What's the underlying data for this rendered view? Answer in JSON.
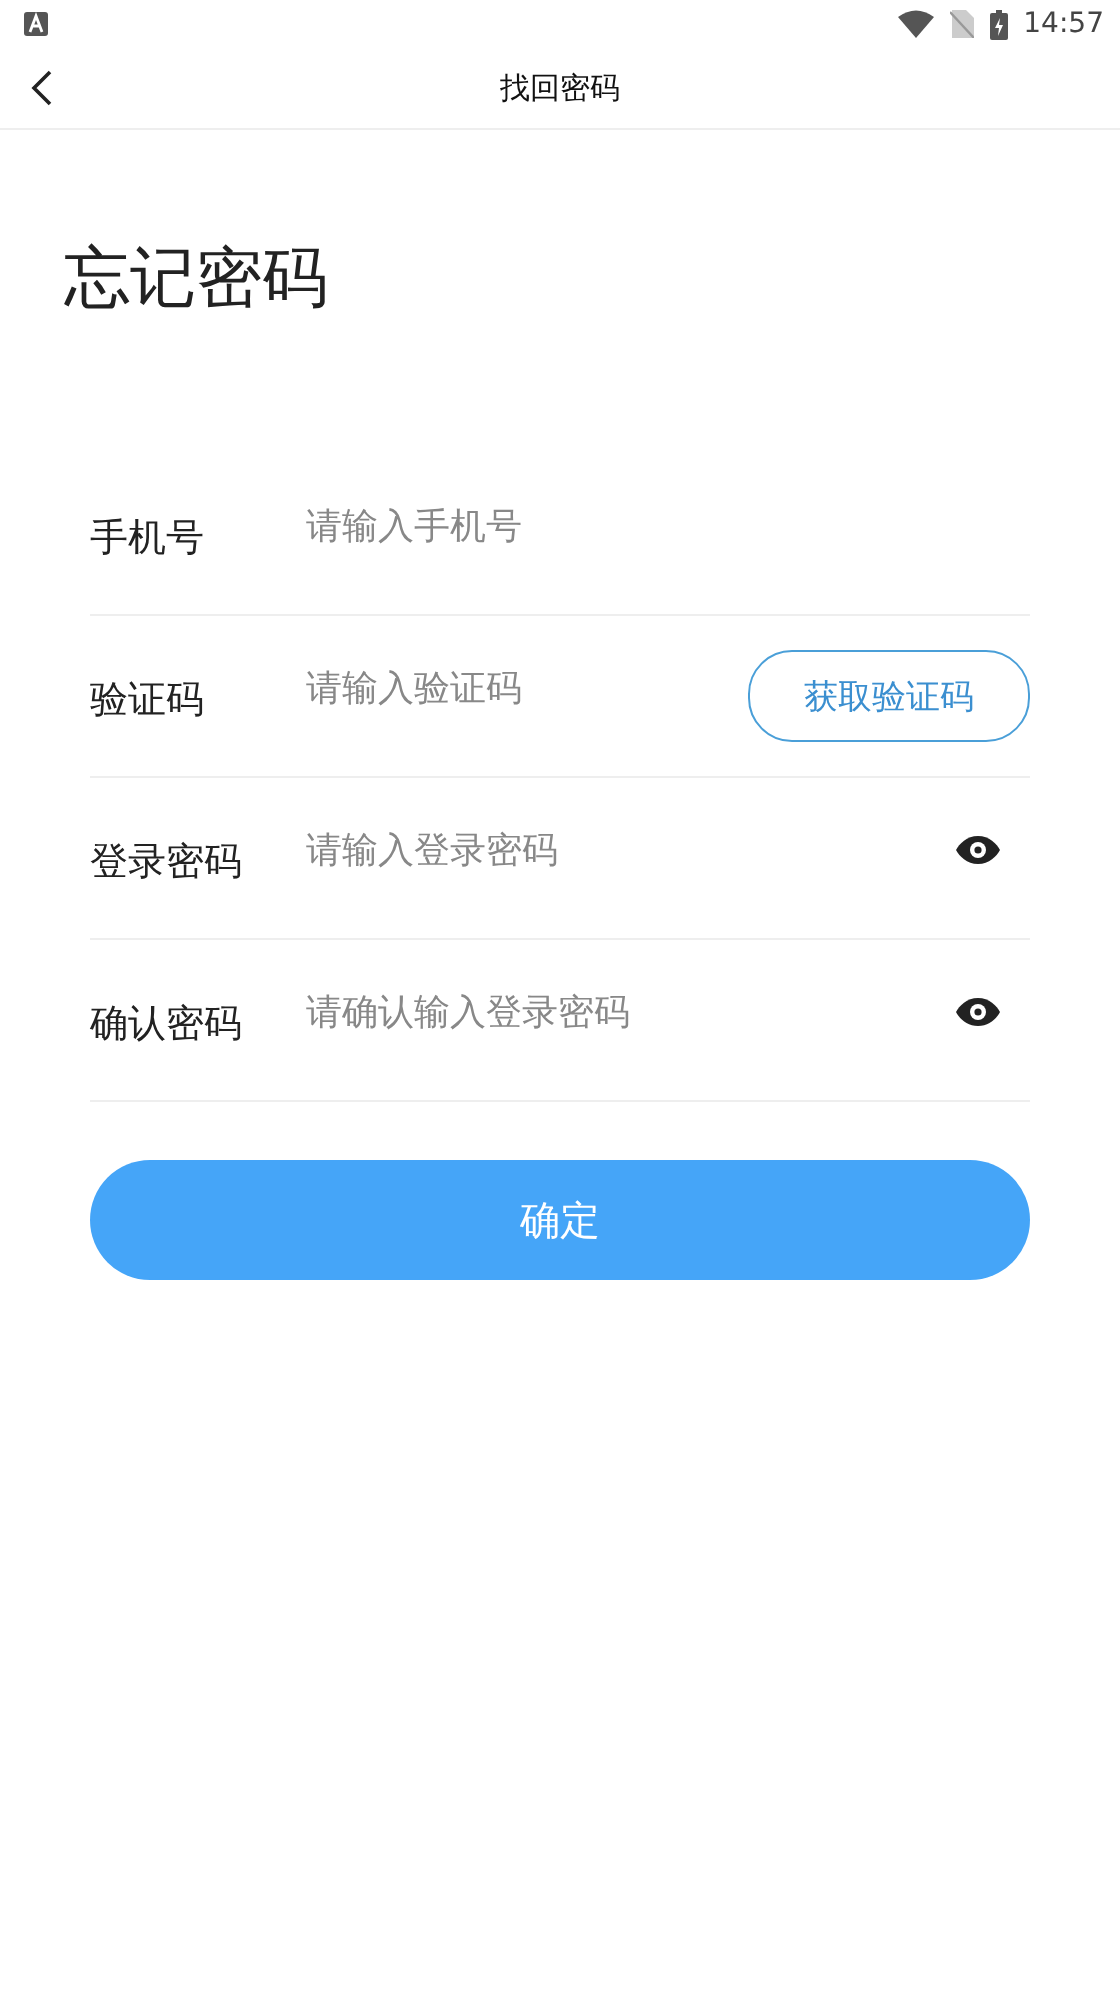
{
  "status_bar": {
    "time": "14:57"
  },
  "app_bar": {
    "title": "找回密码"
  },
  "heading": "忘记密码",
  "fields": [
    {
      "kind": "text",
      "label": "手机号",
      "placeholder": "请输入手机号"
    },
    {
      "kind": "code",
      "label": "验证码",
      "placeholder": "请输入验证码",
      "action": "获取验证码"
    },
    {
      "kind": "password",
      "label": "登录密码",
      "placeholder": "请输入登录密码"
    },
    {
      "kind": "password",
      "label": "确认密码",
      "placeholder": "请确认输入登录密码"
    }
  ],
  "submit": "确定"
}
